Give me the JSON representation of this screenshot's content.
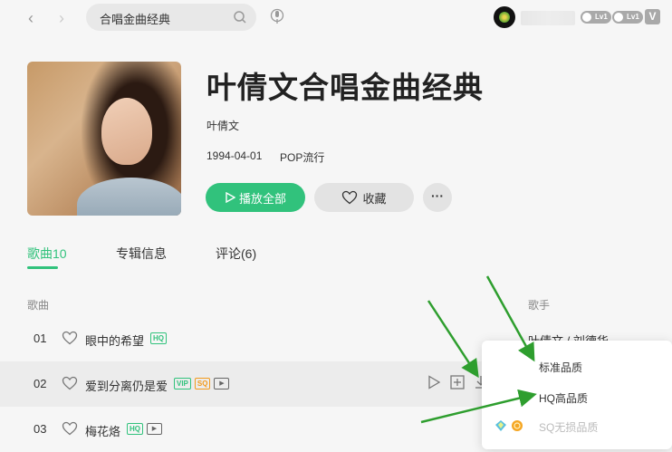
{
  "search": {
    "query": "合唱金曲经典"
  },
  "user": {
    "badges": [
      "Lv1",
      "Lv1"
    ]
  },
  "album": {
    "title": "叶倩文合唱金曲经典",
    "artist": "叶倩文",
    "release_date": "1994-04-01",
    "genre": "POP流行",
    "play_all_label": "播放全部",
    "favorite_label": "收藏",
    "more_label": "···"
  },
  "tabs": [
    {
      "label": "歌曲10",
      "active": true
    },
    {
      "label": "专辑信息",
      "active": false
    },
    {
      "label": "评论(6)",
      "active": false
    }
  ],
  "columns": {
    "song": "歌曲",
    "singer": "歌手"
  },
  "songs": [
    {
      "index": "01",
      "title": "眼中的希望",
      "tags": [
        "HQ"
      ],
      "singer": "叶倩文 / 刘德华"
    },
    {
      "index": "02",
      "title": "爱到分离仍是爱",
      "tags": [
        "VIP",
        "SQ",
        "MV"
      ],
      "singer": ""
    },
    {
      "index": "03",
      "title": "梅花烙",
      "tags": [
        "HQ",
        "MV"
      ],
      "singer": ""
    }
  ],
  "quality_menu": {
    "items": [
      {
        "label": "标准品质",
        "enabled": true
      },
      {
        "label": "HQ高品质",
        "enabled": true
      },
      {
        "label": "SQ无损品质",
        "enabled": false
      }
    ]
  },
  "colors": {
    "accent": "#31c27c",
    "annotation_arrow": "#2e9e2e"
  }
}
